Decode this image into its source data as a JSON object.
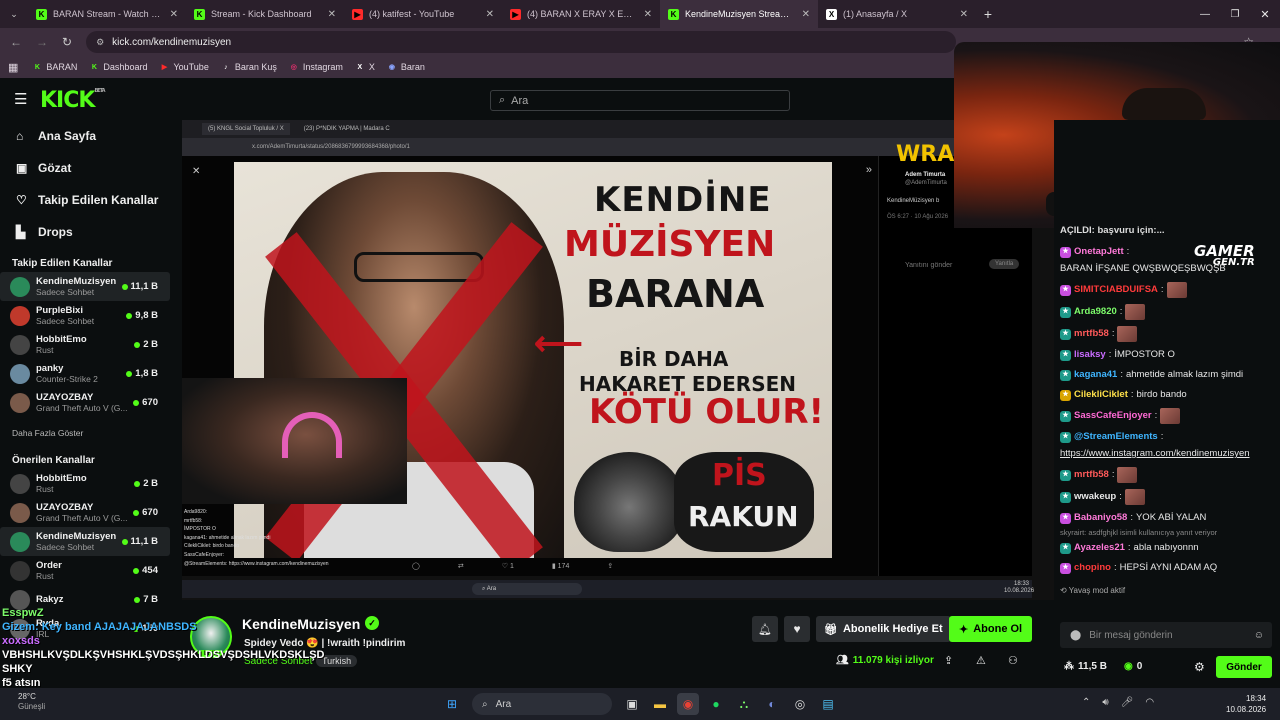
{
  "browser": {
    "tabs": [
      {
        "title": "BARAN Stream - Watch Live on",
        "fav": "K",
        "color": "#53fc18"
      },
      {
        "title": "Stream - Kick Dashboard",
        "fav": "K",
        "color": "#53fc18"
      },
      {
        "title": "(4) katifest - YouTube",
        "fav": "▶",
        "color": "#ff2a2a"
      },
      {
        "title": "(4) BARAN X ERAY X EBONİVO",
        "fav": "▶",
        "color": "#ff2a2a"
      },
      {
        "title": "KendineMuzisyen Stream - Wat",
        "fav": "K",
        "color": "#53fc18"
      },
      {
        "title": "(1) Anasayfa / X",
        "fav": "X",
        "color": "#ffffff"
      }
    ],
    "url": "kick.com/kendinemuzisyen",
    "bookmarks": [
      {
        "label": "BARAN",
        "icon": "K",
        "color": "#53fc18"
      },
      {
        "label": "Dashboard",
        "icon": "K",
        "color": "#53fc18"
      },
      {
        "label": "YouTube",
        "icon": "▶",
        "color": "#ff2a2a"
      },
      {
        "label": "Baran Kuş",
        "icon": "♪",
        "color": "#ffffff"
      },
      {
        "label": "Instagram",
        "icon": "◎",
        "color": "#e1306c"
      },
      {
        "label": "X",
        "icon": "X",
        "color": "#ffffff"
      },
      {
        "label": "Baran",
        "icon": "◉",
        "color": "#8aa4ff"
      }
    ]
  },
  "kick": {
    "logo": "KICK",
    "beta": "BETA",
    "search_placeholder": "Ara",
    "accent": "#53fc18"
  },
  "sidebar": {
    "nav": [
      {
        "label": "Ana Sayfa",
        "icon": "home-icon"
      },
      {
        "label": "Gözat",
        "icon": "browse-icon"
      },
      {
        "label": "Takip Edilen Kanallar",
        "icon": "heart-icon"
      },
      {
        "label": "Drops",
        "icon": "drops-icon"
      }
    ],
    "followed_title": "Takip Edilen Kanallar",
    "followed": [
      {
        "name": "KendineMuzisyen",
        "sub": "Sadece Sohbet",
        "viewers": "11,1 B",
        "color": "#2a8a5a",
        "selected": true
      },
      {
        "name": "PurpleBixi",
        "sub": "Sadece Sohbet",
        "viewers": "9,8 B",
        "color": "#c0392b"
      },
      {
        "name": "HobbitEmo",
        "sub": "Rust",
        "viewers": "2 B",
        "color": "#444"
      },
      {
        "name": "panky",
        "sub": "Counter-Strike 2",
        "viewers": "1,8 B",
        "color": "#6a8aa0"
      },
      {
        "name": "UZAYOZBAY",
        "sub": "Grand Theft Auto V (G...",
        "viewers": "670",
        "color": "#7a5a4a"
      }
    ],
    "show_more": "Daha Fazla Göster",
    "recommended_title": "Önerilen Kanallar",
    "recommended": [
      {
        "name": "HobbitEmo",
        "sub": "Rust",
        "viewers": "2 B",
        "color": "#444"
      },
      {
        "name": "UZAYOZBAY",
        "sub": "Grand Theft Auto V (G...",
        "viewers": "670",
        "color": "#7a5a4a"
      },
      {
        "name": "KendineMuzisyen",
        "sub": "Sadece Sohbet",
        "viewers": "11,1 B",
        "color": "#2a8a5a"
      },
      {
        "name": "Order",
        "sub": "Rust",
        "viewers": "454",
        "color": "#333"
      },
      {
        "name": "Rakyz",
        "sub": "",
        "viewers": "7 B",
        "color": "#555"
      },
      {
        "name": "Ryda",
        "sub": "IRL",
        "viewers": "150",
        "color": "#666"
      }
    ]
  },
  "video": {
    "inner_tabs": [
      "(5) KNGL Social Topluluk / X",
      "(23) P*NDIK YAPMA | Madara C"
    ],
    "inner_url": "x.com/AdemTimurta/status/2086836799993684368/photo/1",
    "poster": {
      "line1": "KENDİNE",
      "line2": "MÜZİSYEN",
      "line3": "BARANA",
      "line4": "BİR DAHA",
      "line5": "HAKARET EDERSEN",
      "line6": "KÖTÜ OLUR!",
      "pis1": "PİS",
      "pis2": "RAKUN"
    },
    "tweet_author": "Adem Timurta",
    "tweet_handle": "@AdemTimurta",
    "tweet_text": "KendineMüzisyen b",
    "tweet_time": "ÖS 6:27 · 10 Ağu 2026",
    "reply_placeholder": "Yanıtını gönder",
    "reply_button": "Yanıtla",
    "overlay_brand": "WRA",
    "inner_chat": [
      "Arda9820:",
      "mrtfb58:",
      "İMPOSTOR O",
      "kagana41: ahmetide almak lazım şimdi",
      "CilekliCiklet: birdo bando",
      "SassCafeEnjoyer:",
      "@StreamElements: https://www.instagram.com/kendinemuzisyen"
    ],
    "inner_search": "Ara",
    "inner_time": "18:33",
    "inner_date": "10.08.2026",
    "tweet_likes": "1",
    "tweet_views": "174"
  },
  "chat": {
    "top_line": "AÇILDI: başvuru için:...",
    "brand": "GAMER",
    "brand2": "GEN.TR",
    "messages": [
      {
        "user": "OnetapJett",
        "color": "#ff7ad9",
        "text": "BARAN İFŞANE QWŞBWQEŞBWQŞB",
        "badge": "#c94fe0"
      },
      {
        "user": "SIMITCIABDUIFSA",
        "color": "#ff3b3b",
        "text": "",
        "emote": true,
        "badge": "#c94fe0"
      },
      {
        "user": "Arda9820",
        "color": "#7dfc6b",
        "text": "",
        "emote": true,
        "badge": "#1e9a8a"
      },
      {
        "user": "mrtfb58",
        "color": "#ff5a5a",
        "text": "",
        "emote": true,
        "badge": "#1e9a8a"
      },
      {
        "user": "lisaksy",
        "color": "#c96cff",
        "text": "İMPOSTOR O",
        "badge": "#1e9a8a"
      },
      {
        "user": "kagana41",
        "color": "#3fb5ff",
        "text": "ahmetide almak lazım şimdi",
        "badge": "#1e9a8a"
      },
      {
        "user": "CilekliCiklet",
        "color": "#ffe14a",
        "text": "birdo bando",
        "badge": "#d9a400"
      },
      {
        "user": "SassCafeEnjoyer",
        "color": "#ff6ad5",
        "text": "",
        "emote": true,
        "badge": "#1e9a8a"
      },
      {
        "user": "@StreamElements",
        "color": "#3fb5ff",
        "text": "https://www.instagram.com/kendinemuzisyen",
        "badge": "#1e9a8a"
      },
      {
        "user": "mrtfb58",
        "color": "#ff5a5a",
        "text": "",
        "emote": true,
        "badge": "#1e9a8a"
      },
      {
        "user": "wwakeup",
        "color": "#e8e8e8",
        "text": "",
        "emote": true,
        "badge": "#1e9a8a"
      },
      {
        "user": "Babaniyo58",
        "color": "#ff7ad9",
        "text": "YOK ABİ YALAN",
        "badge": "#c94fe0"
      },
      {
        "user": "Ayazeles21",
        "color": "#ff7ad9",
        "text": "abla nabıyonnn",
        "badge": "#1e9a8a",
        "reply": "skyrairt: asdfghjkl isimli kullanıcıya yanıt veriyor"
      },
      {
        "user": "chopino",
        "color": "#ff3b3b",
        "text": "HEPSİ AYNI ADAM AQ",
        "badge": "#c94fe0"
      }
    ],
    "slow_mode": "Yavaş mod aktif",
    "input_placeholder": "Bir mesaj gönderin",
    "send_label": "Gönder",
    "kicks_count": "11,5 B",
    "points": "0"
  },
  "stream": {
    "channel": "KendineMuzisyen",
    "title": "Spidey Vedo 😍 | !wraith !pindirim",
    "category": "Sadece Sohbet",
    "tag": "Turkish",
    "live": "LIVE",
    "viewers": "11.079 kişi izliyor",
    "gift_label": "Abonelik Hediye Et",
    "subscribe_label": "Abone Ol"
  },
  "overlay_chat": [
    {
      "text": "EsspwZ",
      "color": "#7dfc6b"
    },
    {
      "text": "Gizem: Key band AJAJAJAJANBSDS",
      "color": "#3fb5ff"
    },
    {
      "text": "xoxsds",
      "color": "#c96cff"
    },
    {
      "text": "VBHSHLKVŞDLKŞVHSHKLŞVDSŞHKLDSVŞDSHLVKDSKLŞD",
      "color": "#ffffff"
    },
    {
      "text": "SHKY",
      "color": "#ffffff"
    },
    {
      "text": "f5 atsın",
      "color": "#ffffff"
    }
  ],
  "taskbar": {
    "weather": "28°C",
    "weather_sub": "Güneşli",
    "search": "Ara",
    "time": "18:34",
    "date": "10.08.2026"
  }
}
